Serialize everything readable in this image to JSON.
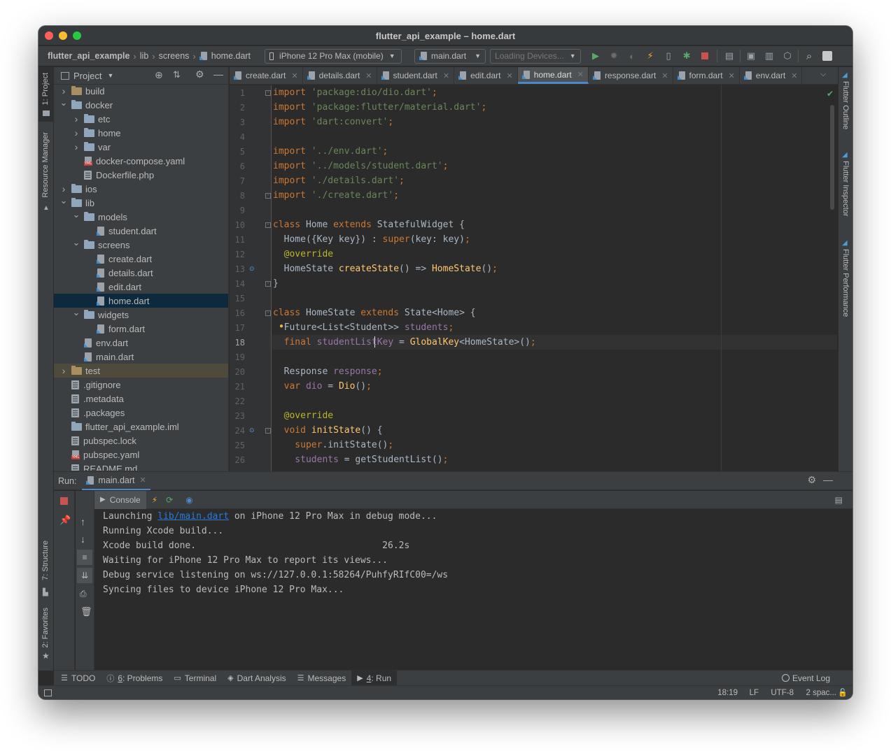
{
  "window": {
    "title": "flutter_api_example – home.dart"
  },
  "navbar": {
    "breadcrumbs": [
      "flutter_api_example",
      "lib",
      "screens",
      "home.dart"
    ],
    "device_selector": "iPhone 12 Pro Max (mobile)",
    "run_config": "main.dart",
    "devices_loading": "Loading Devices..."
  },
  "left_strip": {
    "project_tab": "1: Project",
    "resource_manager": "Resource Manager",
    "structure": "7: Structure",
    "favorites": "2: Favorites"
  },
  "right_strip": {
    "outline": "Flutter Outline",
    "inspector": "Flutter Inspector",
    "performance": "Flutter Performance"
  },
  "project_panel": {
    "title": "Project",
    "tree": [
      {
        "label": "build",
        "type": "folder-excluded",
        "depth": 1,
        "expand": "collapsed"
      },
      {
        "label": "docker",
        "type": "folder",
        "depth": 1,
        "expand": "expanded"
      },
      {
        "label": "etc",
        "type": "folder",
        "depth": 2,
        "expand": "collapsed"
      },
      {
        "label": "home",
        "type": "folder",
        "depth": 2,
        "expand": "collapsed"
      },
      {
        "label": "var",
        "type": "folder",
        "depth": 2,
        "expand": "collapsed"
      },
      {
        "label": "docker-compose.yaml",
        "type": "yaml",
        "depth": 2,
        "expand": "none"
      },
      {
        "label": "Dockerfile.php",
        "type": "text",
        "depth": 2,
        "expand": "none"
      },
      {
        "label": "ios",
        "type": "folder",
        "depth": 1,
        "expand": "collapsed"
      },
      {
        "label": "lib",
        "type": "folder",
        "depth": 1,
        "expand": "expanded"
      },
      {
        "label": "models",
        "type": "folder",
        "depth": 2,
        "expand": "expanded"
      },
      {
        "label": "student.dart",
        "type": "dart",
        "depth": 3,
        "expand": "none"
      },
      {
        "label": "screens",
        "type": "folder",
        "depth": 2,
        "expand": "expanded"
      },
      {
        "label": "create.dart",
        "type": "dart",
        "depth": 3,
        "expand": "none"
      },
      {
        "label": "details.dart",
        "type": "dart",
        "depth": 3,
        "expand": "none"
      },
      {
        "label": "edit.dart",
        "type": "dart",
        "depth": 3,
        "expand": "none"
      },
      {
        "label": "home.dart",
        "type": "dart",
        "depth": 3,
        "expand": "none",
        "selected": true
      },
      {
        "label": "widgets",
        "type": "folder",
        "depth": 2,
        "expand": "expanded"
      },
      {
        "label": "form.dart",
        "type": "dart",
        "depth": 3,
        "expand": "none"
      },
      {
        "label": "env.dart",
        "type": "dart",
        "depth": 2,
        "expand": "none"
      },
      {
        "label": "main.dart",
        "type": "dart",
        "depth": 2,
        "expand": "none"
      },
      {
        "label": "test",
        "type": "folder-excluded",
        "depth": 1,
        "expand": "collapsed",
        "highlight": true
      },
      {
        "label": ".gitignore",
        "type": "text",
        "depth": 1,
        "expand": "none"
      },
      {
        "label": ".metadata",
        "type": "text",
        "depth": 1,
        "expand": "none"
      },
      {
        "label": ".packages",
        "type": "text",
        "depth": 1,
        "expand": "none"
      },
      {
        "label": "flutter_api_example.iml",
        "type": "iml",
        "depth": 1,
        "expand": "none"
      },
      {
        "label": "pubspec.lock",
        "type": "text",
        "depth": 1,
        "expand": "none"
      },
      {
        "label": "pubspec.yaml",
        "type": "yaml",
        "depth": 1,
        "expand": "none"
      },
      {
        "label": "README.md",
        "type": "text",
        "depth": 1,
        "expand": "none"
      }
    ]
  },
  "tabs": [
    {
      "label": "create.dart",
      "active": false
    },
    {
      "label": "details.dart",
      "active": false
    },
    {
      "label": "student.dart",
      "active": false
    },
    {
      "label": "edit.dart",
      "active": false
    },
    {
      "label": "home.dart",
      "active": true
    },
    {
      "label": "response.dart",
      "active": false
    },
    {
      "label": "form.dart",
      "active": false
    },
    {
      "label": "env.dart",
      "active": false
    }
  ],
  "editor": {
    "current_line": 18,
    "lines": [
      [
        [
          "k",
          "import "
        ],
        [
          "s",
          "'package:dio/dio.dart'"
        ],
        [
          "k",
          ";"
        ]
      ],
      [
        [
          "k",
          "import "
        ],
        [
          "s",
          "'package:flutter/material.dart'"
        ],
        [
          "k",
          ";"
        ]
      ],
      [
        [
          "k",
          "import "
        ],
        [
          "s",
          "'dart:convert'"
        ],
        [
          "k",
          ";"
        ]
      ],
      [],
      [
        [
          "k",
          "import "
        ],
        [
          "s",
          "'../env.dart'"
        ],
        [
          "k",
          ";"
        ]
      ],
      [
        [
          "k",
          "import "
        ],
        [
          "s",
          "'../models/student.dart'"
        ],
        [
          "k",
          ";"
        ]
      ],
      [
        [
          "k",
          "import "
        ],
        [
          "s",
          "'./details.dart'"
        ],
        [
          "k",
          ";"
        ]
      ],
      [
        [
          "k",
          "import "
        ],
        [
          "s",
          "'./create.dart'"
        ],
        [
          "k",
          ";"
        ]
      ],
      [],
      [
        [
          "k",
          "class "
        ],
        [
          "pl",
          "Home "
        ],
        [
          "k",
          "extends "
        ],
        [
          "pl",
          "StatefulWidget {"
        ]
      ],
      [
        [
          "pl",
          "  Home({Key key}) : "
        ],
        [
          "k",
          "super"
        ],
        [
          "pl",
          "(key: key)"
        ],
        [
          "k",
          ";"
        ]
      ],
      [
        [
          "an",
          "  @override"
        ]
      ],
      [
        [
          "pl",
          "  HomeState "
        ],
        [
          "fn",
          "createState"
        ],
        [
          "pl",
          "() => "
        ],
        [
          "cl",
          "HomeState"
        ],
        [
          "pl",
          "()"
        ],
        [
          "k",
          ";"
        ]
      ],
      [
        [
          "pl",
          "}"
        ]
      ],
      [],
      [
        [
          "k",
          "class "
        ],
        [
          "pl",
          "HomeState "
        ],
        [
          "k",
          "extends "
        ],
        [
          "pl",
          "State<Home> {"
        ]
      ],
      [
        [
          "pl",
          "  Future<List<Student>> "
        ],
        [
          "fd",
          "students"
        ],
        [
          "k",
          ";"
        ]
      ],
      [
        [
          "k",
          "  final "
        ],
        [
          "fd",
          "studentListKey"
        ],
        [
          "pl",
          " = "
        ],
        [
          "cl",
          "GlobalKey"
        ],
        [
          "pl",
          "<HomeState>()"
        ],
        [
          "k",
          ";"
        ]
      ],
      [],
      [
        [
          "pl",
          "  Response "
        ],
        [
          "fd",
          "response"
        ],
        [
          "k",
          ";"
        ]
      ],
      [
        [
          "k",
          "  var "
        ],
        [
          "fd",
          "dio"
        ],
        [
          "pl",
          " = "
        ],
        [
          "cl",
          "Dio"
        ],
        [
          "pl",
          "()"
        ],
        [
          "k",
          ";"
        ]
      ],
      [],
      [
        [
          "an",
          "  @override"
        ]
      ],
      [
        [
          "k",
          "  void "
        ],
        [
          "fn",
          "initState"
        ],
        [
          "pl",
          "() {"
        ]
      ],
      [
        [
          "k",
          "    super"
        ],
        [
          "pl",
          "."
        ],
        [
          "pl",
          "initState()"
        ],
        [
          "k",
          ";"
        ]
      ],
      [
        [
          "fd",
          "    students"
        ],
        [
          "pl",
          " = getStudentList()"
        ],
        [
          "k",
          ";"
        ]
      ]
    ]
  },
  "run_panel": {
    "title": "Run:",
    "config_tab": "main.dart",
    "console_label": "Console",
    "output": [
      {
        "pre": "Launching ",
        "link": "lib/main.dart",
        "post": " on iPhone 12 Pro Max in debug mode..."
      },
      {
        "pre": "Running Xcode build...",
        "link": "",
        "post": ""
      },
      {
        "pre": "Xcode build done.                                  26.2s",
        "link": "",
        "post": ""
      },
      {
        "pre": "Waiting for iPhone 12 Pro Max to report its views...",
        "link": "",
        "post": ""
      },
      {
        "pre": "Debug service listening on ws://127.0.0.1:58264/PuhfyRIfC00=/ws",
        "link": "",
        "post": ""
      },
      {
        "pre": "Syncing files to device iPhone 12 Pro Max...",
        "link": "",
        "post": ""
      }
    ]
  },
  "bottom_tools": [
    {
      "num": "",
      "label": "TODO",
      "icon": "list-icon"
    },
    {
      "num": "6",
      "label": ": Problems",
      "icon": "problems-icon"
    },
    {
      "num": "",
      "label": "Terminal",
      "icon": "terminal-icon"
    },
    {
      "num": "",
      "label": "Dart Analysis",
      "icon": "dart-analysis-icon"
    },
    {
      "num": "",
      "label": "Messages",
      "icon": "messages-icon"
    },
    {
      "num": "4",
      "label": ": Run",
      "icon": "run-icon",
      "active": true
    }
  ],
  "event_log": "Event Log",
  "status": {
    "position": "18:19",
    "line_sep": "LF",
    "encoding": "UTF-8",
    "indent": "2 spac..."
  },
  "colors": {
    "bg": "#2b2b2b",
    "panel": "#3c3f41",
    "keyword": "#cc7832",
    "string": "#6a8759",
    "field": "#9876aa",
    "function": "#ffc66d",
    "selection": "#0d293e",
    "accent": "#4a88c7"
  }
}
